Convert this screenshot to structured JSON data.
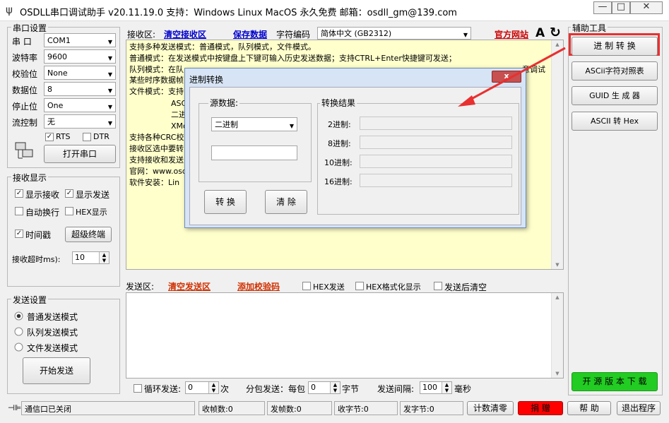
{
  "window": {
    "title": "OSDLL串口调试助手 v20.11.19.0 支持：Windows  Linux  MacOS   永久免费   邮箱：osdll_gm@139.com",
    "min_label": "—",
    "max_label": "□",
    "close_label": "✕"
  },
  "serial": {
    "group_title": "串口设置",
    "port_label": "串  口",
    "port_value": "COM1",
    "baud_label": "波特率",
    "baud_value": "9600",
    "parity_label": "校验位",
    "parity_value": "None",
    "databits_label": "数据位",
    "databits_value": "8",
    "stopbits_label": "停止位",
    "stopbits_value": "One",
    "flow_label": "流控制",
    "flow_value": "无",
    "rts_label": "RTS",
    "dtr_label": "DTR",
    "open_button": "打开串口"
  },
  "recv_display": {
    "group_title": "接收显示",
    "show_recv": "显示接收",
    "show_send": "显示发送",
    "auto_wrap": "自动换行",
    "hex_show": "HEX显示",
    "timestamp": "时间戳",
    "super_terminal": "超级终端",
    "timeout_label": "接收超时ms):",
    "timeout_value": "10"
  },
  "send_settings": {
    "group_title": "发送设置",
    "mode_normal": "普通发送模式",
    "mode_queue": "队列发送模式",
    "mode_file": "文件发送模式",
    "start_button": "开始发送"
  },
  "recv_area": {
    "label": "接收区:",
    "clear_link": "清空接收区",
    "save_link": "保存数据",
    "encoding_label": "字符编码",
    "encoding_value": "简体中文 (GB2312)",
    "website_link": "官方网站",
    "font_icon_label": "A",
    "lines": [
      "支持多种发送模式：普通模式，队列模式，文件模式。",
      "普通模式：在发送模式中按键盘上下键可输入历史发送数据；支持CTRL+Enter快捷键可发送；",
      "队列模式：在队",
      "某些时序数据帧",
      "文件模式：支持",
      "ASC",
      "二进",
      "XMo",
      "支持各种CRC校",
      "接收区选中要转",
      "支持接收和发送",
      "官网：www.osd",
      "软件安装：Lin"
    ],
    "line3_tail": "意调试"
  },
  "send_area": {
    "label": "发送区:",
    "clear_link": "清空发送区",
    "checksum_link": "添加校验码",
    "hex_send": "HEX发送",
    "hex_format": "HEX格式化显示",
    "clear_after": "发送后清空",
    "loop_label": "循环发送:",
    "loop_value": "0",
    "loop_unit": "次",
    "packet_label": "分包发送：每包",
    "packet_value": "0",
    "packet_unit": "字节",
    "interval_label": "发送间隔:",
    "interval_value": "100",
    "interval_unit": "毫秒"
  },
  "tools": {
    "group_title": "辅助工具",
    "base_convert": "进 制 转 换",
    "ascii_table": "ASCii字符对照表",
    "guid": "GUID 生 成 器",
    "ascii_hex": "ASCII 转 Hex",
    "opensource": "开 源 版 本 下 载"
  },
  "statusbar": {
    "port_status": "通信口已关闭",
    "recv_frames": "收帧数:0",
    "send_frames": "发帧数:0",
    "recv_bytes": "收字节:0",
    "send_bytes": "发字节:0",
    "reset_count": "计数清零",
    "donate": "捐 赠",
    "help": "帮  助",
    "exit": "退出程序"
  },
  "dialog": {
    "title": "进制转换",
    "close_label": "x",
    "source_title": "源数据:",
    "source_select": "二进制",
    "source_input": "",
    "result_title": "转换结果",
    "bin_label": "2进制:",
    "oct_label": "8进制:",
    "dec_label": "10进制:",
    "hex_label": "16进制:",
    "convert_button": "转 换",
    "clear_button": "清 除"
  },
  "colors": {
    "recv_bg": "#ffffcc",
    "highlight_red": "#e83030",
    "donate_red": "#ff0000",
    "opensource_green": "#22cc22"
  }
}
